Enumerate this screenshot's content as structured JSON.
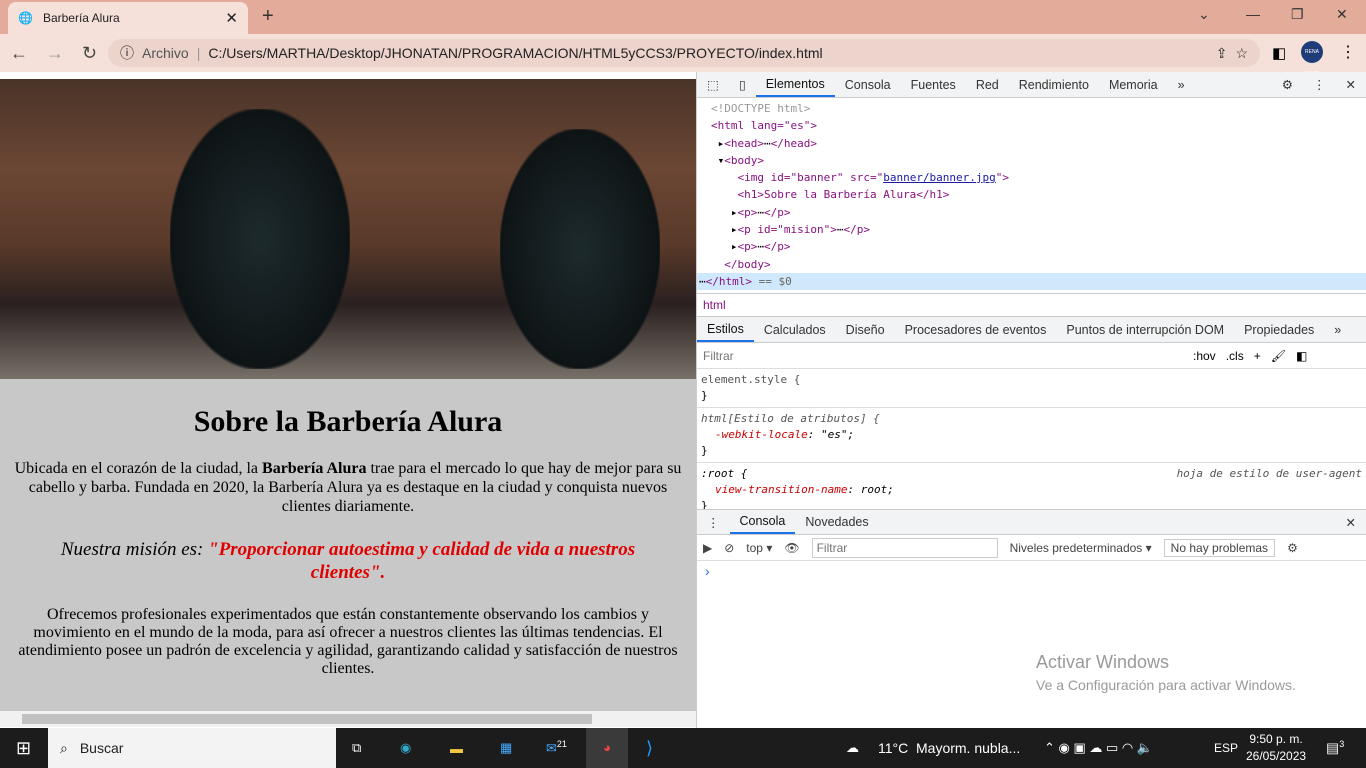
{
  "browser": {
    "tab_title": "Barbería Alura",
    "security_label": "Archivo",
    "url": "C:/Users/MARTHA/Desktop/JHONATAN/PROGRAMACION/HTML5yCCS3/PROYECTO/index.html",
    "profile_label": "RENA WARE"
  },
  "page": {
    "heading": "Sobre la Barbería Alura",
    "p1_before": "Ubicada en el corazón de la ciudad, la ",
    "p1_bold": "Barbería Alura",
    "p1_after": " trae para el mercado lo que hay de mejor para su cabello y barba. Fundada en 2020, la Barbería Alura ya es destaque en la ciudad y conquista nuevos clientes diariamente.",
    "mision_label": "Nuestra misión es: ",
    "mision_text": "\"Proporcionar autoestima y calidad de vida a nuestros clientes\".",
    "p3": "Ofrecemos profesionales experimentados que están constantemente observando los cambios y movimiento en el mundo de la moda, para así ofrecer a nuestros clientes las últimas tendencias. El atendimiento posee un padrón de excelencia y agilidad, garantizando calidad y satisfacción de nuestros clientes."
  },
  "devtools": {
    "tabs": [
      "Elementos",
      "Consola",
      "Fuentes",
      "Red",
      "Rendimiento",
      "Memoria"
    ],
    "dom": {
      "doctype": "<!DOCTYPE html>",
      "html_open": "<html lang=\"es\">",
      "head": "<head>",
      "head_close": "</head>",
      "body": "<body>",
      "img_pre": "<img id=\"banner\" src=\"",
      "img_src": "banner/banner.jpg",
      "img_post": "\">",
      "h1": "<h1>Sobre la Barbería Alura</h1>",
      "p": "<p>",
      "p_close": "</p>",
      "p_mision": "<p id=\"mision\">",
      "body_close": "</body>",
      "html_close": "</html>",
      "sel_marker": "== $0"
    },
    "breadcrumb": "html",
    "style_tabs": [
      "Estilos",
      "Calculados",
      "Diseño",
      "Procesadores de eventos",
      "Puntos de interrupción DOM",
      "Propiedades"
    ],
    "filter_placeholder": "Filtrar",
    "hov": ":hov",
    "cls": ".cls",
    "rules": {
      "r1": "element.style {",
      "r2": "html[Estilo de atributos] {",
      "r2_prop": "-webkit-locale",
      "r2_val": "\"es\";",
      "r3": ":root {",
      "r3_src": "hoja de estilo de user-agent",
      "r3_prop": "view-transition-name",
      "r3_val": "root;",
      "close": "}"
    },
    "drawer_tabs": [
      "Consola",
      "Novedades"
    ],
    "console": {
      "context": "top",
      "filter_placeholder": "Filtrar",
      "levels": "Niveles predeterminados",
      "issues": "No hay problemas",
      "prompt": "›"
    }
  },
  "watermark": {
    "title": "Activar Windows",
    "subtitle": "Ve a Configuración para activar Windows."
  },
  "taskbar": {
    "search": "Buscar",
    "weather_temp": "11°C",
    "weather_text": "Mayorm. nubla...",
    "lang": "ESP",
    "time": "9:50 p. m.",
    "date": "26/05/2023",
    "notif_count": "3",
    "mail_badge": "21"
  }
}
